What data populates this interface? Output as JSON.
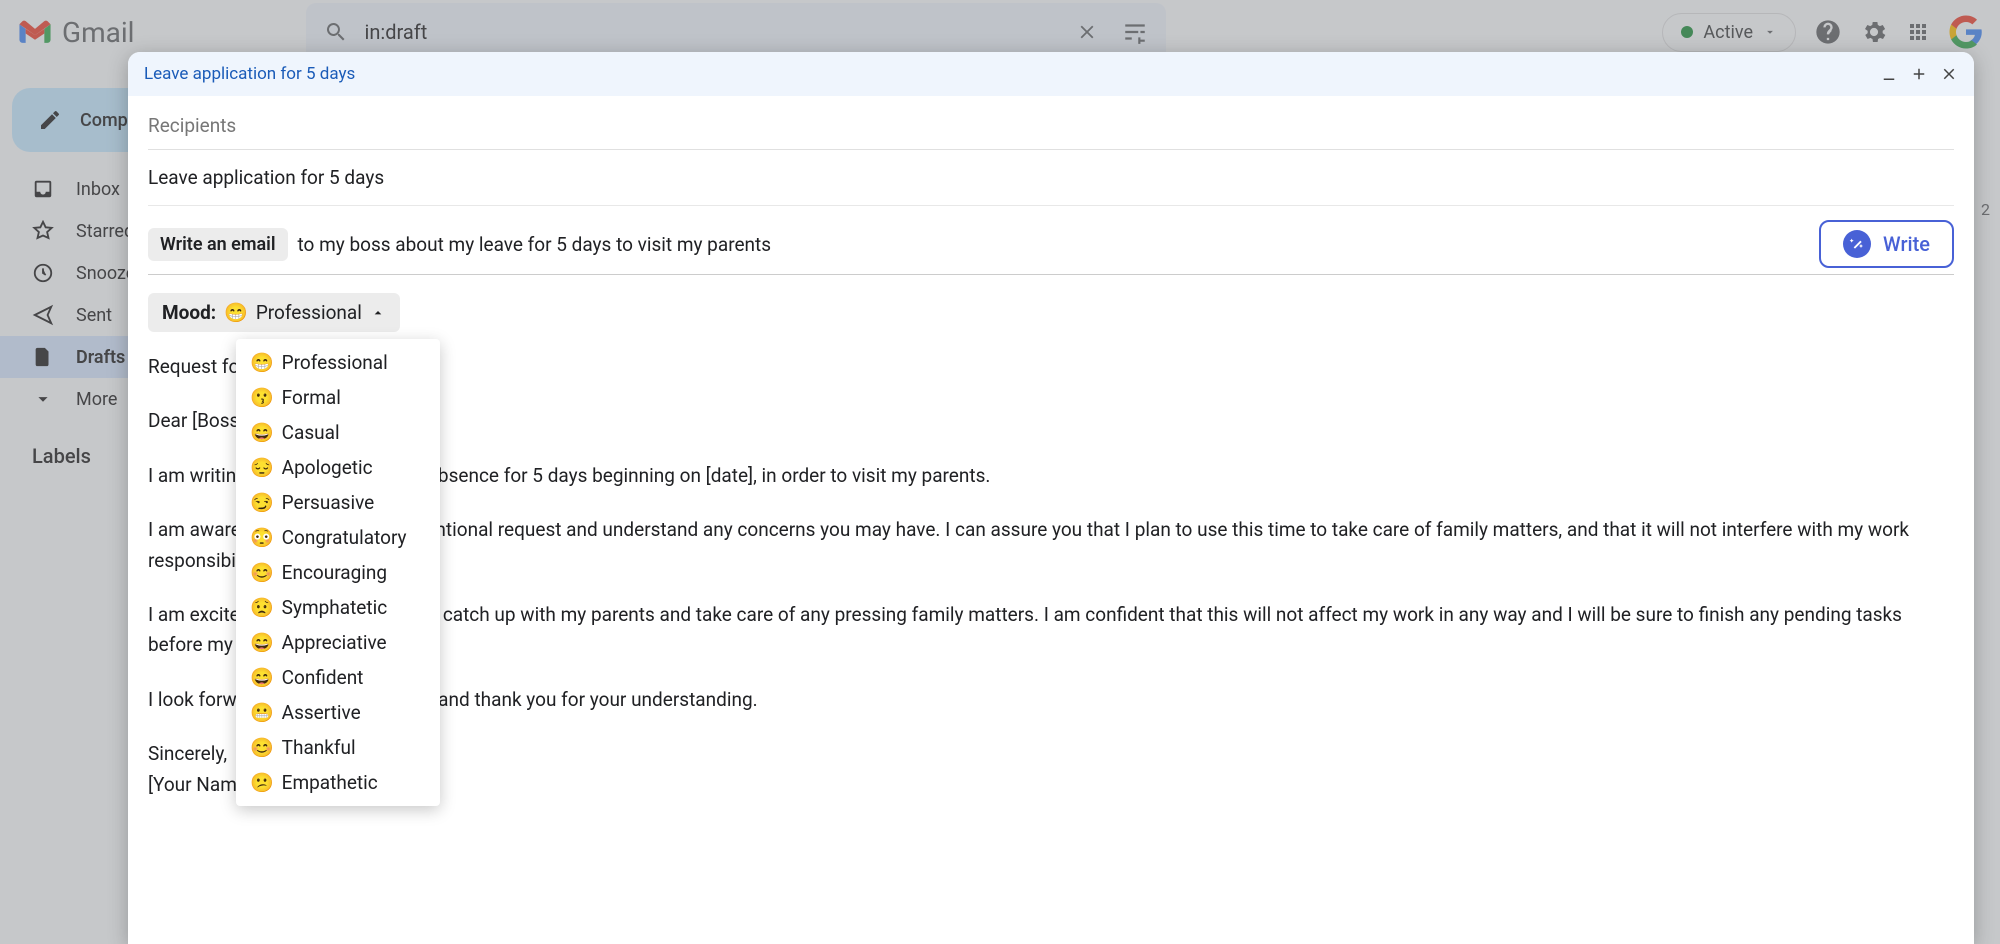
{
  "header": {
    "app_name": "Gmail",
    "search_value": "in:draft",
    "status_label": "Active"
  },
  "sidebar": {
    "compose_label": "Compose",
    "items": [
      {
        "label": "Inbox"
      },
      {
        "label": "Starred"
      },
      {
        "label": "Snoozed"
      },
      {
        "label": "Sent"
      },
      {
        "label": "Drafts"
      },
      {
        "label": "More"
      }
    ],
    "labels_header": "Labels"
  },
  "dialog": {
    "title": "Leave application for 5 days",
    "recipients_placeholder": "Recipients",
    "subject": "Leave application for 5 days",
    "write_chip": "Write an email",
    "write_prompt": "to my boss about my leave for 5 days to visit my parents",
    "write_button": "Write",
    "mood_label": "Mood:",
    "mood_selected": "Professional",
    "mood_options": [
      "Professional",
      "Formal",
      "Casual",
      "Apologetic",
      "Persuasive",
      "Congratulatory",
      "Encouraging",
      "Symphatetic",
      "Appreciative",
      "Confident",
      "Assertive",
      "Thankful",
      "Empathetic"
    ],
    "body_paragraphs": [
      "Request for Leave of Absence",
      "Dear [Boss],",
      "I am writing to request a leave of absence for 5 days beginning on [date], in order to visit my parents.",
      "I am aware that this is an unconventional request and understand any concerns you may have. I can assure you that I plan to use this time to take care of family matters, and that it will not interfere with my work responsibilities or workload.",
      "I am excited for this opportunity to catch up with my parents and take care of any pressing family matters. I am confident that this will not affect my work in any way and I will be sure to finish any pending tasks before my leave.",
      "I look forward to hearing from you and thank you for your understanding.",
      "Sincerely,\n[Your Name]"
    ]
  },
  "misc": {
    "count_2": "2"
  }
}
